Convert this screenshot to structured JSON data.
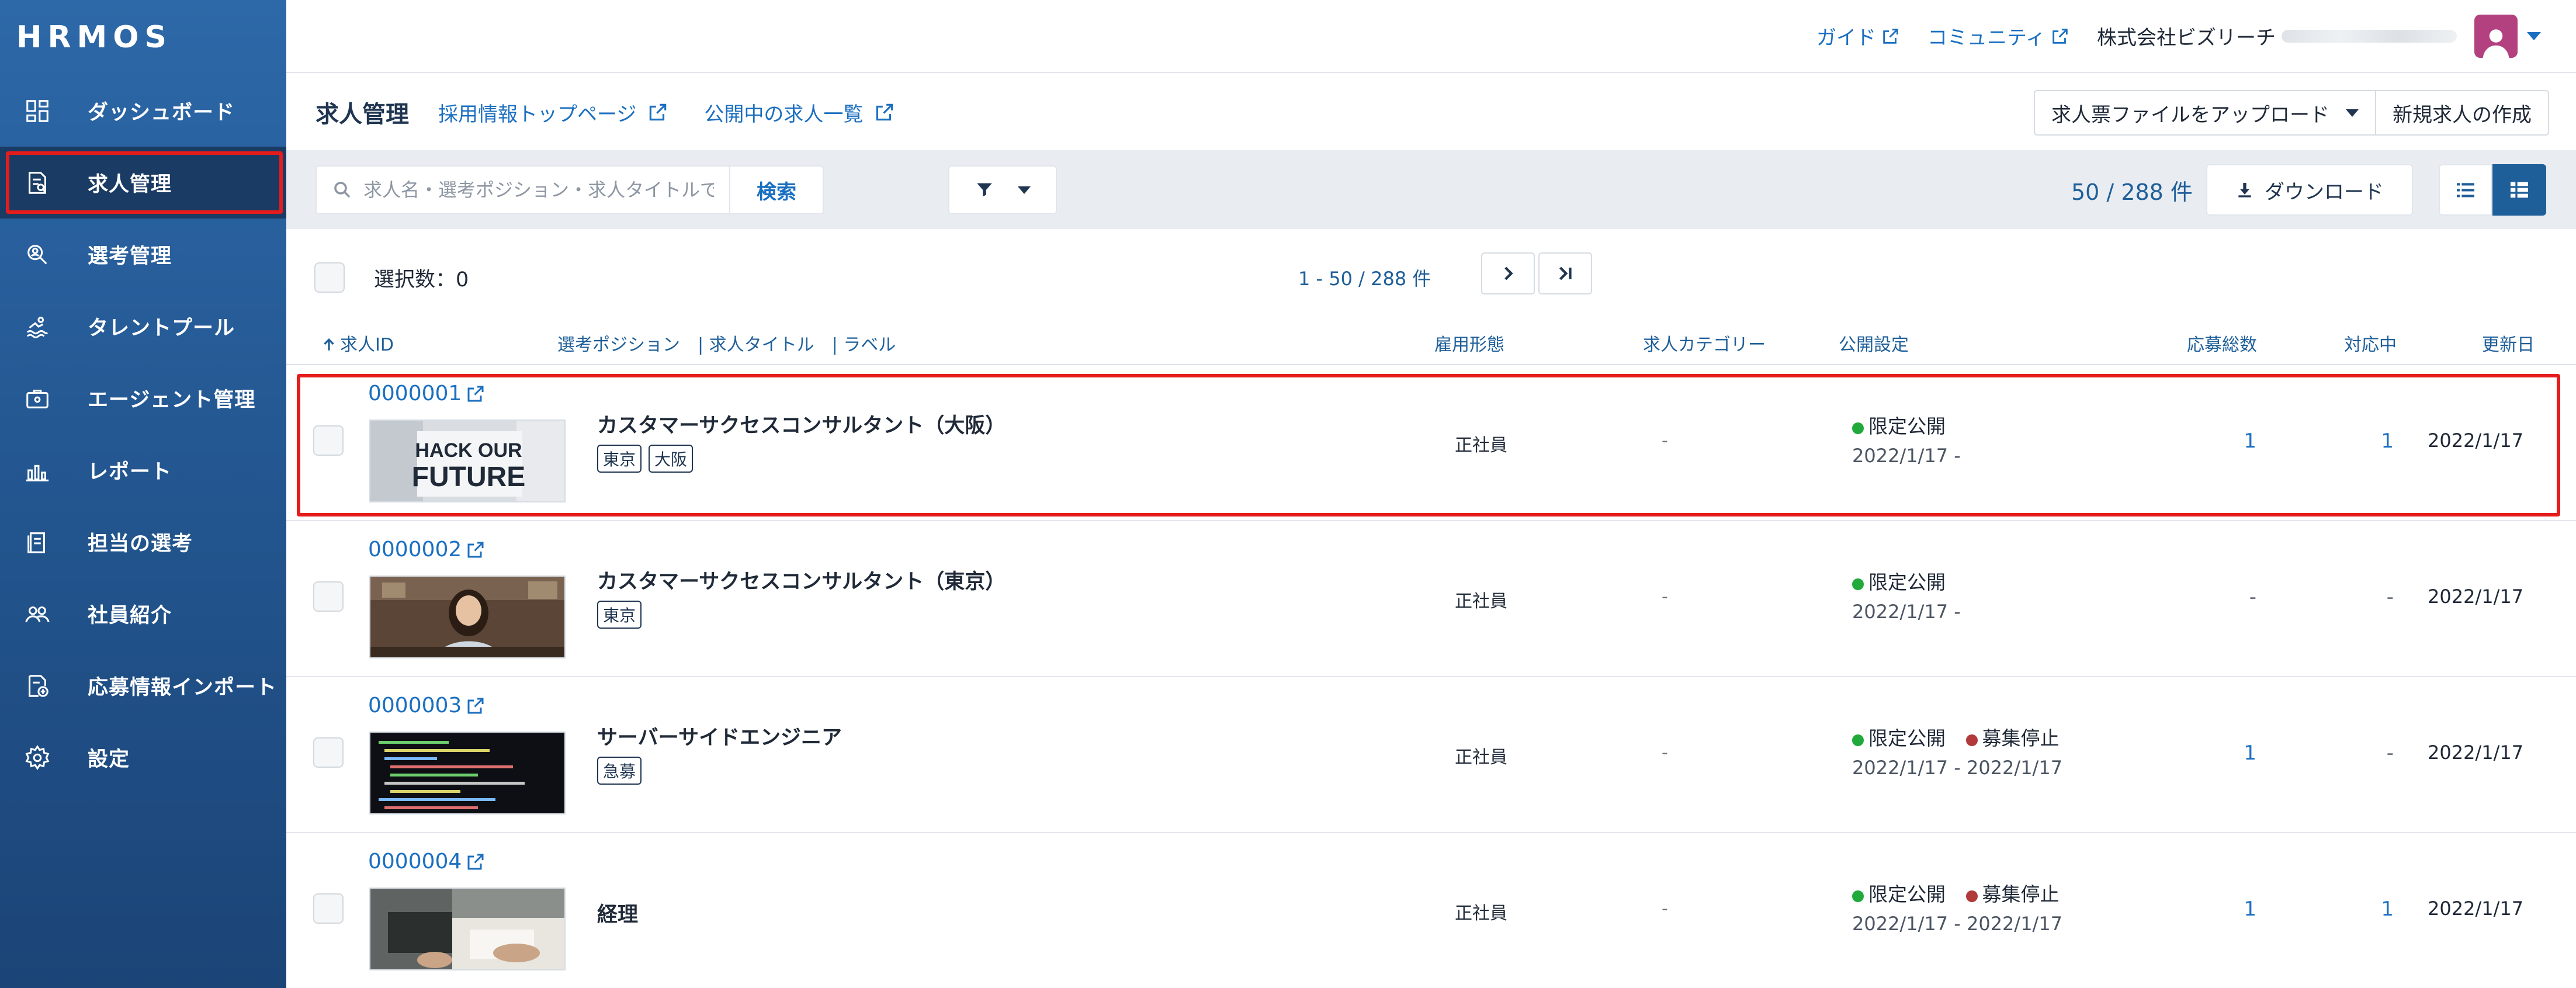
{
  "brand": {
    "logo": "HRMOS"
  },
  "sidebar": {
    "items": [
      {
        "label": "ダッシュボード",
        "icon": "dashboard-icon"
      },
      {
        "label": "求人管理",
        "icon": "job-document-icon",
        "active": true
      },
      {
        "label": "選考管理",
        "icon": "search-person-icon"
      },
      {
        "label": "タレントプール",
        "icon": "pool-icon"
      },
      {
        "label": "エージェント管理",
        "icon": "briefcase-icon"
      },
      {
        "label": "レポート",
        "icon": "bar-chart-icon"
      },
      {
        "label": "担当の選考",
        "icon": "assigned-doc-icon"
      },
      {
        "label": "社員紹介",
        "icon": "people-icon"
      },
      {
        "label": "応募情報インポート",
        "icon": "import-icon"
      },
      {
        "label": "設定",
        "icon": "gear-icon"
      }
    ]
  },
  "header": {
    "guide": "ガイド",
    "community": "コミュニティ",
    "company": "株式会社ビズリーチ"
  },
  "page": {
    "title": "求人管理",
    "links": {
      "top_page": "採用情報トップページ",
      "public_jobs": "公開中の求人一覧"
    },
    "upload_button": "求人票ファイルをアップロード",
    "new_job_button": "新規求人の作成"
  },
  "toolbar": {
    "search_placeholder": "求人名・選考ポジション・求人タイトルで検索",
    "search_button": "検索",
    "count": "50 / 288 件",
    "download": "ダウンロード"
  },
  "selection": {
    "label": "選択数：0",
    "page_range": "1 - 50 / 288 件"
  },
  "columns": {
    "job_id": "求人ID",
    "position": "選考ポジション　|  求人タイトル　|  ラベル",
    "employment": "雇用形態",
    "category": "求人カテゴリー",
    "publish": "公開設定",
    "applications": "応募総数",
    "in_progress": "対応中",
    "updated": "更新日"
  },
  "jobs": [
    {
      "id": "0000001",
      "title": "カスタマーサクセスコンサルタント（大阪）",
      "tags": [
        "東京",
        "大阪"
      ],
      "thumb_text": [
        "HACK OUR",
        "FUTURE"
      ],
      "employment": "正社員",
      "category": "-",
      "status": "限定公開",
      "status2": "",
      "dates": "2022/1/17 -",
      "applications": "1",
      "in_progress": "1",
      "updated": "2022/1/17"
    },
    {
      "id": "0000002",
      "title": "カスタマーサクセスコンサルタント（東京）",
      "tags": [
        "東京"
      ],
      "employment": "正社員",
      "category": "-",
      "status": "限定公開",
      "status2": "",
      "dates": "2022/1/17 -",
      "applications": "-",
      "in_progress": "-",
      "updated": "2022/1/17"
    },
    {
      "id": "0000003",
      "title": "サーバーサイドエンジニア",
      "tags": [
        "急募"
      ],
      "employment": "正社員",
      "category": "-",
      "status": "限定公開",
      "status2": "募集停止",
      "dates": "2022/1/17 - 2022/1/17",
      "applications": "1",
      "in_progress": "-",
      "updated": "2022/1/17"
    },
    {
      "id": "0000004",
      "title": "経理",
      "tags": [],
      "employment": "正社員",
      "category": "-",
      "status": "限定公開",
      "status2": "募集停止",
      "dates": "2022/1/17 - 2022/1/17",
      "applications": "1",
      "in_progress": "1",
      "updated": "2022/1/17"
    }
  ],
  "colors": {
    "sidebar_top": "#2d68a8",
    "sidebar_bottom": "#1b4477",
    "accent": "#1b6fc0",
    "highlight": "#e51c1c",
    "status_green": "#1faa3b",
    "status_red": "#b23a3a"
  }
}
